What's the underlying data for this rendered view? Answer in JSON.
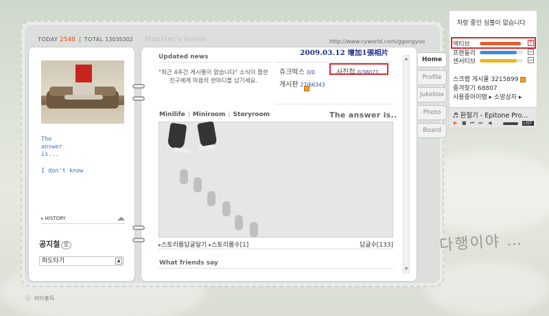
{
  "topbar": {
    "today_label": "TODAY",
    "today_value": "2548",
    "total_label": "TOTAL",
    "total_value": "13035302"
  },
  "header": {
    "title": "Monster's house",
    "url": "http://www.cyworld.com/ggongyoo"
  },
  "profile": {
    "text_lines": [
      "The",
      "answer",
      "is..."
    ],
    "text2": "I don't know",
    "history_label": "HISTORY",
    "notice_label": "공지철",
    "notice_badge": "호",
    "select_value": "파도타기"
  },
  "copyright": "ⓒ 러브홍득",
  "updated": {
    "label": "Updated news",
    "message": "\"최근 4주간 게시물이 없습니다\" 소식이 뜸한 친구에게 마음의 한마디를 남기세요."
  },
  "annotation": "2009.03.12 增加1張相片",
  "stats": {
    "jukebox_label": "쥬크박스",
    "jukebox_value": "0/0",
    "photo_label": "사진첩",
    "photo_value": "0/38071",
    "board_label": "게시판",
    "board_value": "27/66343"
  },
  "miniroom": {
    "tab_minilife": "Minilife",
    "tab_miniroom": "Miniroom",
    "tab_storyroom": "Storyroom",
    "answer_text": "The answer is..",
    "story_reply": "스토리룸답글달기",
    "story_count_label": "스토리룸수",
    "story_count": "[1]",
    "reply_count": "답글수[133]"
  },
  "friends_label": "What friends say",
  "tabs": [
    "Home",
    "Profile",
    "Jukebox",
    "Photo",
    "Board"
  ],
  "widget": {
    "title": "자랑 중인 심볼이 없습니다",
    "rows": [
      {
        "label": "액티브",
        "value": 0.95,
        "color": "#e0602c"
      },
      {
        "label": "프렌들리",
        "value": 0.85,
        "color": "#3a8fd4"
      },
      {
        "label": "센서티브",
        "value": 0.85,
        "color": "#f0b21c"
      }
    ],
    "scrap": "스크랩 게시물 3215899",
    "fav": "즐겨찾기 68807",
    "items": "사용중아이템 ▸ 소망상자 ▸"
  },
  "player": {
    "song": "♬ 환절기 - Epitone Pro...",
    "list": "LIST"
  },
  "signature": "다행이야 …"
}
